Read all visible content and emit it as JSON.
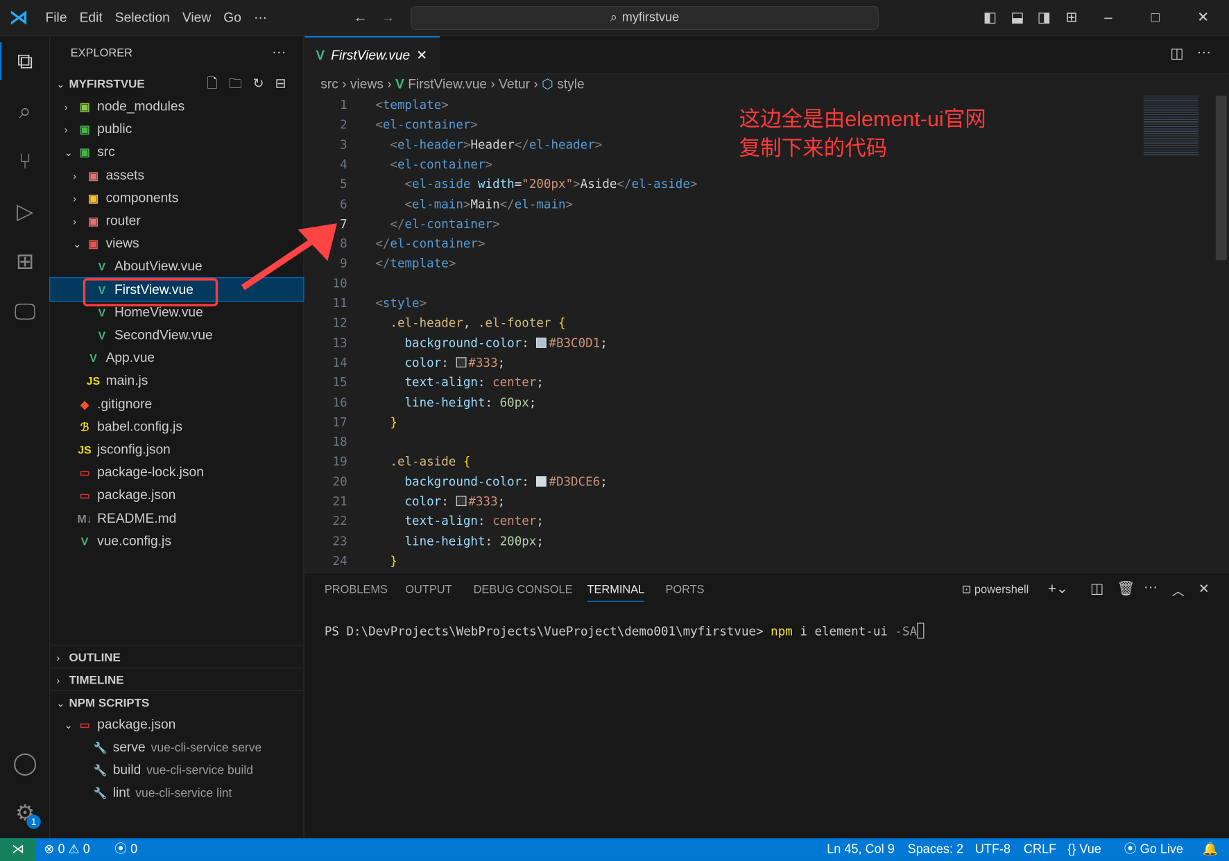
{
  "menu": [
    "File",
    "Edit",
    "Selection",
    "View",
    "Go",
    "···"
  ],
  "search": "myfirstvue",
  "explorer": {
    "title": "EXPLORER",
    "root": "MYFIRSTVUE",
    "items": [
      {
        "label": "node_modules",
        "depth": 1,
        "chev": "›",
        "icon": "folder-node-icon",
        "glyph": "▣",
        "color": "#8bc34a"
      },
      {
        "label": "public",
        "depth": 1,
        "chev": "›",
        "icon": "folder-public-icon",
        "glyph": "▣",
        "color": "#4caf50"
      },
      {
        "label": "src",
        "depth": 1,
        "chev": "⌄",
        "icon": "folder-src-icon",
        "glyph": "▣",
        "color": "#4caf50"
      },
      {
        "label": "assets",
        "depth": 2,
        "chev": "›",
        "icon": "folder-assets-icon",
        "glyph": "▣",
        "color": "#e57373"
      },
      {
        "label": "components",
        "depth": 2,
        "chev": "›",
        "icon": "folder-components-icon",
        "glyph": "▣",
        "color": "#fbc02d"
      },
      {
        "label": "router",
        "depth": 2,
        "chev": "›",
        "icon": "folder-router-icon",
        "glyph": "▣",
        "color": "#e57373"
      },
      {
        "label": "views",
        "depth": 2,
        "chev": "⌄",
        "icon": "folder-views-icon",
        "glyph": "▣",
        "color": "#ef5350"
      },
      {
        "label": "AboutView.vue",
        "depth": 3,
        "chev": "",
        "icon": "vue-file-icon",
        "glyph": "V",
        "color": "#41b883"
      },
      {
        "label": "FirstView.vue",
        "depth": 3,
        "chev": "",
        "icon": "vue-file-icon",
        "glyph": "V",
        "color": "#41b883",
        "selected": true
      },
      {
        "label": "HomeView.vue",
        "depth": 3,
        "chev": "",
        "icon": "vue-file-icon",
        "glyph": "V",
        "color": "#41b883"
      },
      {
        "label": "SecondView.vue",
        "depth": 3,
        "chev": "",
        "icon": "vue-file-icon",
        "glyph": "V",
        "color": "#41b883"
      },
      {
        "label": "App.vue",
        "depth": 2,
        "chev": "",
        "icon": "vue-file-icon",
        "glyph": "V",
        "color": "#41b883"
      },
      {
        "label": "main.js",
        "depth": 2,
        "chev": "",
        "icon": "js-file-icon",
        "glyph": "JS",
        "color": "#f5de19"
      },
      {
        "label": ".gitignore",
        "depth": 1,
        "chev": "",
        "icon": "git-file-icon",
        "glyph": "◆",
        "color": "#f05133"
      },
      {
        "label": "babel.config.js",
        "depth": 1,
        "chev": "",
        "icon": "babel-file-icon",
        "glyph": "ℬ",
        "color": "#f5de19"
      },
      {
        "label": "jsconfig.json",
        "depth": 1,
        "chev": "",
        "icon": "js-config-icon",
        "glyph": "JS",
        "color": "#f5de19"
      },
      {
        "label": "package-lock.json",
        "depth": 1,
        "chev": "",
        "icon": "npm-file-icon",
        "glyph": "▭",
        "color": "#cb3837"
      },
      {
        "label": "package.json",
        "depth": 1,
        "chev": "",
        "icon": "npm-file-icon",
        "glyph": "▭",
        "color": "#cb3837"
      },
      {
        "label": "README.md",
        "depth": 1,
        "chev": "",
        "icon": "markdown-file-icon",
        "glyph": "M↓",
        "color": "#888"
      },
      {
        "label": "vue.config.js",
        "depth": 1,
        "chev": "",
        "icon": "vue-config-icon",
        "glyph": "V",
        "color": "#41b883"
      }
    ],
    "outline": "OUTLINE",
    "timeline": "TIMELINE",
    "npm": "NPM SCRIPTS",
    "npm_file": "package.json",
    "scripts": [
      {
        "name": "serve",
        "cmd": "vue-cli-service serve"
      },
      {
        "name": "build",
        "cmd": "vue-cli-service build"
      },
      {
        "name": "lint",
        "cmd": "vue-cli-service lint"
      }
    ]
  },
  "tab": {
    "label": "FirstView.vue"
  },
  "breadcrumb": [
    "src",
    "views",
    "FirstView.vue",
    "Vetur",
    "style"
  ],
  "current_line": 7,
  "code": [
    [
      [
        "br",
        "<"
      ],
      [
        "tg",
        "template"
      ],
      [
        "br",
        ">"
      ]
    ],
    [
      [
        "br",
        "<"
      ],
      [
        "tg",
        "el-container"
      ],
      [
        "br",
        ">"
      ]
    ],
    [
      [
        "tx",
        "  "
      ],
      [
        "br",
        "<"
      ],
      [
        "tg",
        "el-header"
      ],
      [
        "br",
        ">"
      ],
      [
        "tx",
        "Header"
      ],
      [
        "br",
        "</"
      ],
      [
        "tg",
        "el-header"
      ],
      [
        "br",
        ">"
      ]
    ],
    [
      [
        "tx",
        "  "
      ],
      [
        "br",
        "<"
      ],
      [
        "tg",
        "el-container"
      ],
      [
        "br",
        ">"
      ]
    ],
    [
      [
        "tx",
        "    "
      ],
      [
        "br",
        "<"
      ],
      [
        "tg",
        "el-aside"
      ],
      [
        "tx",
        " "
      ],
      [
        "at",
        "width"
      ],
      [
        "tx",
        "="
      ],
      [
        "st",
        "\"200px\""
      ],
      [
        "br",
        ">"
      ],
      [
        "tx",
        "Aside"
      ],
      [
        "br",
        "</"
      ],
      [
        "tg",
        "el-aside"
      ],
      [
        "br",
        ">"
      ]
    ],
    [
      [
        "tx",
        "    "
      ],
      [
        "br",
        "<"
      ],
      [
        "tg",
        "el-main"
      ],
      [
        "br",
        ">"
      ],
      [
        "tx",
        "Main"
      ],
      [
        "br",
        "</"
      ],
      [
        "tg",
        "el-main"
      ],
      [
        "br",
        ">"
      ]
    ],
    [
      [
        "tx",
        "  "
      ],
      [
        "br",
        "</"
      ],
      [
        "tg",
        "el-container"
      ],
      [
        "br",
        ">"
      ]
    ],
    [
      [
        "br",
        "</"
      ],
      [
        "tg",
        "el-container"
      ],
      [
        "br",
        ">"
      ]
    ],
    [
      [
        "br",
        "</"
      ],
      [
        "tg",
        "template"
      ],
      [
        "br",
        ">"
      ]
    ],
    [],
    [
      [
        "br",
        "<"
      ],
      [
        "tg",
        "style"
      ],
      [
        "br",
        ">"
      ]
    ],
    [
      [
        "tx",
        "  "
      ],
      [
        "sel",
        ".el-header"
      ],
      [
        "tx",
        ", "
      ],
      [
        "sel",
        ".el-footer"
      ],
      [
        "tx",
        " "
      ],
      [
        "cb",
        "{"
      ]
    ],
    [
      [
        "tx",
        "    "
      ],
      [
        "pr",
        "background-color"
      ],
      [
        "tx",
        ": "
      ],
      [
        "sw",
        "#B3C0D1"
      ],
      [
        "st",
        "#B3C0D1"
      ],
      [
        "tx",
        ";"
      ]
    ],
    [
      [
        "tx",
        "    "
      ],
      [
        "pr",
        "color"
      ],
      [
        "tx",
        ": "
      ],
      [
        "sw",
        "#333"
      ],
      [
        "st",
        "#333"
      ],
      [
        "tx",
        ";"
      ]
    ],
    [
      [
        "tx",
        "    "
      ],
      [
        "pr",
        "text-align"
      ],
      [
        "tx",
        ": "
      ],
      [
        "st",
        "center"
      ],
      [
        "tx",
        ";"
      ]
    ],
    [
      [
        "tx",
        "    "
      ],
      [
        "pr",
        "line-height"
      ],
      [
        "tx",
        ": "
      ],
      [
        "nm",
        "60px"
      ],
      [
        "tx",
        ";"
      ]
    ],
    [
      [
        "tx",
        "  "
      ],
      [
        "cb",
        "}"
      ]
    ],
    [],
    [
      [
        "tx",
        "  "
      ],
      [
        "sel",
        ".el-aside"
      ],
      [
        "tx",
        " "
      ],
      [
        "cb",
        "{"
      ]
    ],
    [
      [
        "tx",
        "    "
      ],
      [
        "pr",
        "background-color"
      ],
      [
        "tx",
        ": "
      ],
      [
        "sw",
        "#D3DCE6"
      ],
      [
        "st",
        "#D3DCE6"
      ],
      [
        "tx",
        ";"
      ]
    ],
    [
      [
        "tx",
        "    "
      ],
      [
        "pr",
        "color"
      ],
      [
        "tx",
        ": "
      ],
      [
        "sw",
        "#333"
      ],
      [
        "st",
        "#333"
      ],
      [
        "tx",
        ";"
      ]
    ],
    [
      [
        "tx",
        "    "
      ],
      [
        "pr",
        "text-align"
      ],
      [
        "tx",
        ": "
      ],
      [
        "st",
        "center"
      ],
      [
        "tx",
        ";"
      ]
    ],
    [
      [
        "tx",
        "    "
      ],
      [
        "pr",
        "line-height"
      ],
      [
        "tx",
        ": "
      ],
      [
        "nm",
        "200px"
      ],
      [
        "tx",
        ";"
      ]
    ],
    [
      [
        "tx",
        "  "
      ],
      [
        "cb",
        "}"
      ]
    ]
  ],
  "annotation": {
    "line1": "这边全是由element-ui官网",
    "line2": "复制下来的代码",
    "color": "#ff3b3b"
  },
  "panel": {
    "tabs": [
      "PROBLEMS",
      "OUTPUT",
      "DEBUG CONSOLE",
      "TERMINAL",
      "PORTS"
    ],
    "active": "TERMINAL",
    "shell": "powershell",
    "prompt": "PS D:\\DevProjects\\WebProjects\\VueProject\\demo001\\myfirstvue> ",
    "cmd": "npm",
    "args": " i element-ui",
    "flag": " -SA"
  },
  "status": {
    "errors": "0",
    "warnings": "0",
    "ports": "0",
    "position": "Ln 45, Col 9",
    "spaces": "Spaces: 2",
    "encoding": "UTF-8",
    "eol": "CRLF",
    "language": "Vue",
    "golive": "Go Live"
  },
  "colors": {
    "accent": "#0078d4",
    "status_bar": "#0078d4",
    "remote": "#16825d"
  }
}
